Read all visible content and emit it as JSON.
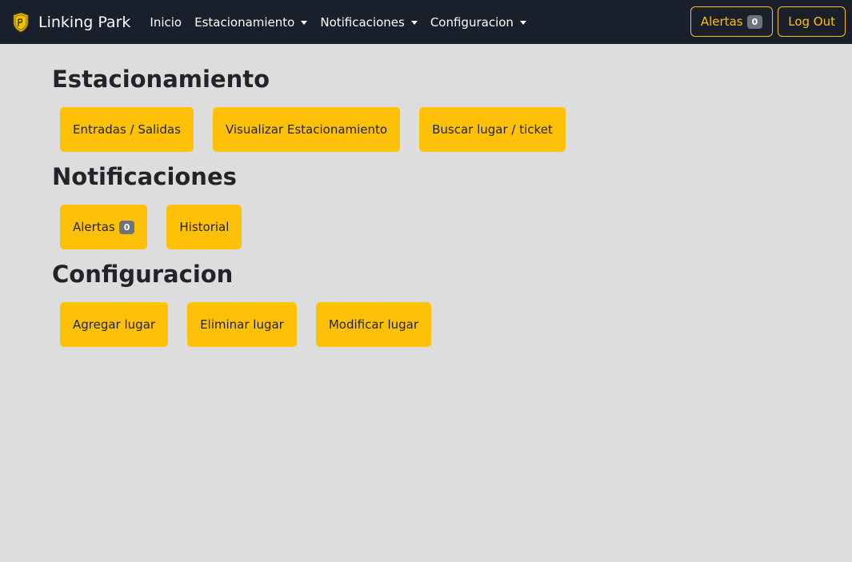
{
  "navbar": {
    "brand": "Linking Park",
    "logo_icon": "shield-logo-icon",
    "items": [
      {
        "label": "Inicio",
        "dropdown": false
      },
      {
        "label": "Estacionamiento",
        "dropdown": true
      },
      {
        "label": "Notificaciones",
        "dropdown": true
      },
      {
        "label": "Configuracion",
        "dropdown": true
      }
    ],
    "alerts_label": "Alertas",
    "alerts_count": "0",
    "logout_label": "Log Out"
  },
  "sections": {
    "parking": {
      "title": "Estacionamiento",
      "buttons": [
        "Entradas / Salidas",
        "Visualizar Estacionamiento",
        "Buscar lugar / ticket"
      ]
    },
    "notifications": {
      "title": "Notificaciones",
      "alerts_label": "Alertas",
      "alerts_count": "0",
      "history_label": "Historial"
    },
    "config": {
      "title": "Configuracion",
      "buttons": [
        "Agregar lugar",
        "Eliminar lugar",
        "Modificar lugar"
      ]
    }
  },
  "colors": {
    "navbar_bg": "#1a1f2c",
    "page_bg": "#dddddd",
    "accent": "#ffc107",
    "badge": "#6c757d"
  }
}
